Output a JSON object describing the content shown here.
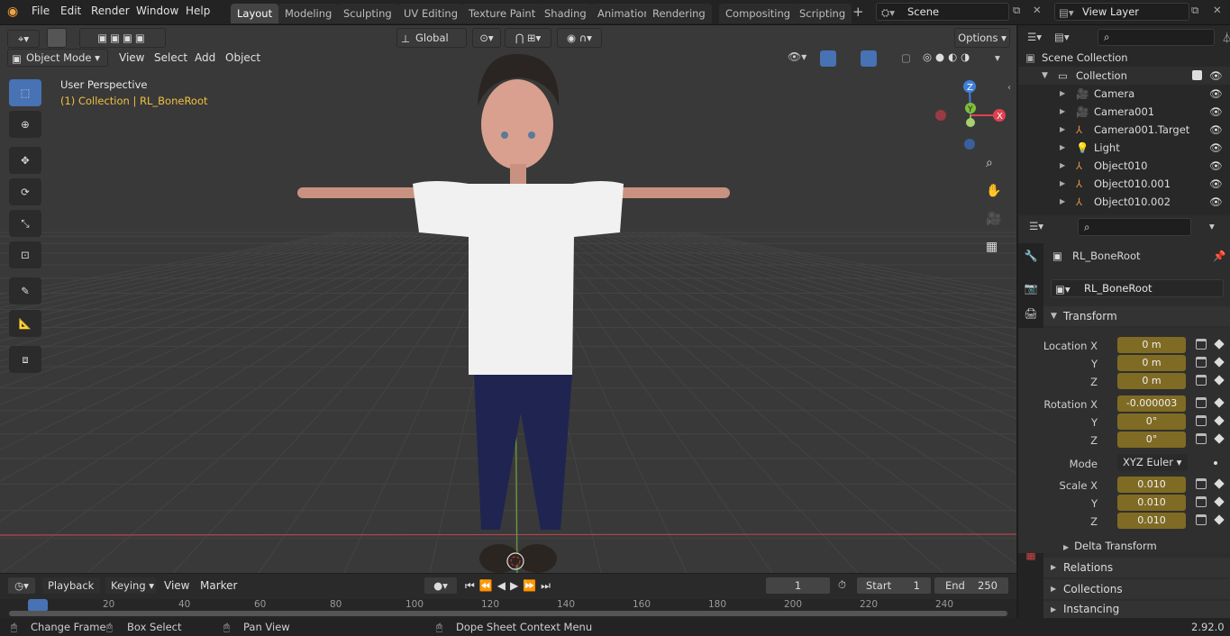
{
  "menu": {
    "file": "File",
    "edit": "Edit",
    "render": "Render",
    "window": "Window",
    "help": "Help"
  },
  "workspaces": [
    "Layout",
    "Modeling",
    "Sculpting",
    "UV Editing",
    "Texture Paint",
    "Shading",
    "Animation",
    "Rendering",
    "Compositing",
    "Scripting"
  ],
  "scene": {
    "name": "Scene",
    "view_layer": "View Layer"
  },
  "toolbar": {
    "orientation": "Global",
    "options": "Options"
  },
  "viewport": {
    "mode": "Object Mode",
    "menus": [
      "View",
      "Select",
      "Add",
      "Object"
    ],
    "perspective": "User Perspective",
    "context": "(1) Collection | RL_BoneRoot"
  },
  "gizmo": {
    "x": "X",
    "y": "Y",
    "z": "Z"
  },
  "outliner": {
    "scene_collection": "Scene Collection",
    "collection": "Collection",
    "items": [
      "Camera",
      "Camera001",
      "Camera001.Target",
      "Light",
      "Object010",
      "Object010.001",
      "Object010.002"
    ]
  },
  "properties": {
    "object_name": "RL_BoneRoot",
    "data_name": "RL_BoneRoot",
    "transform_title": "Transform",
    "location": {
      "label_x": "Location X",
      "label_y": "Y",
      "label_z": "Z",
      "x": "0 m",
      "y": "0 m",
      "z": "0 m"
    },
    "rotation": {
      "label_x": "Rotation X",
      "label_y": "Y",
      "label_z": "Z",
      "x": "-0.000003",
      "y": "0°",
      "z": "0°"
    },
    "mode_label": "Mode",
    "mode": "XYZ Euler",
    "scale": {
      "label_x": "Scale X",
      "label_y": "Y",
      "label_z": "Z",
      "x": "0.010",
      "y": "0.010",
      "z": "0.010"
    },
    "delta": "Delta Transform",
    "relations": "Relations",
    "collections": "Collections",
    "instancing": "Instancing"
  },
  "timeline": {
    "menus": [
      "Playback",
      "Keying",
      "View",
      "Marker"
    ],
    "current_frame": "1",
    "start_label": "Start",
    "start": "1",
    "end_label": "End",
    "end": "250",
    "ruler": [
      "1",
      "20",
      "40",
      "60",
      "80",
      "100",
      "120",
      "140",
      "160",
      "180",
      "200",
      "220",
      "240"
    ]
  },
  "status": {
    "change_frame": "Change Frame",
    "box_select": "Box Select",
    "pan_view": "Pan View",
    "context_menu": "Dope Sheet Context Menu",
    "version": "2.92.0"
  },
  "colors": {
    "accent": "#4772b3",
    "field_anim": "#7f6b24",
    "x_axis": "#e04050",
    "y_axis": "#7fbf3a",
    "z_axis": "#3f7fd8",
    "context_text": "#f0c040"
  }
}
